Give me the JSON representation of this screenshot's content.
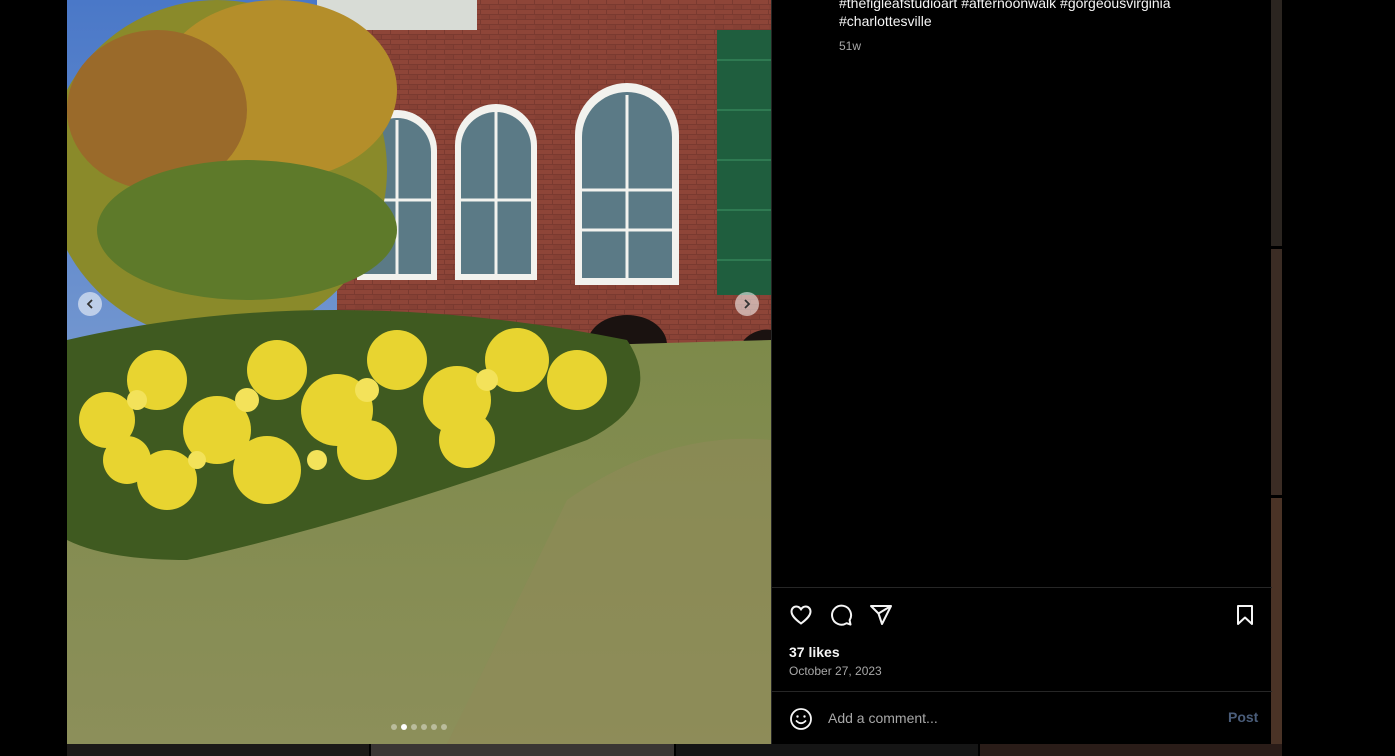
{
  "post": {
    "caption_line1": "#thefigleafstudioart #afternoonwalk #gorgeousvirginia",
    "caption_line2": "#charlottesville",
    "time_ago": "51w",
    "likes": "37 likes",
    "date": "October 27, 2023"
  },
  "carousel": {
    "slide_count": 6,
    "active_index": 1
  },
  "icons": {
    "like": "heart-icon",
    "comment": "comment-icon",
    "share": "paper-plane-icon",
    "save": "bookmark-icon",
    "emoji": "emoji-smile-icon",
    "prev": "chevron-left-icon",
    "next": "chevron-right-icon"
  },
  "comment_box": {
    "placeholder": "Add a comment...",
    "post_label": "Post"
  },
  "colors": {
    "background": "#000000",
    "text": "#f5f5f5",
    "muted": "#a8a8a8",
    "post_disabled": "#4a5d7a",
    "divider": "#262626"
  }
}
